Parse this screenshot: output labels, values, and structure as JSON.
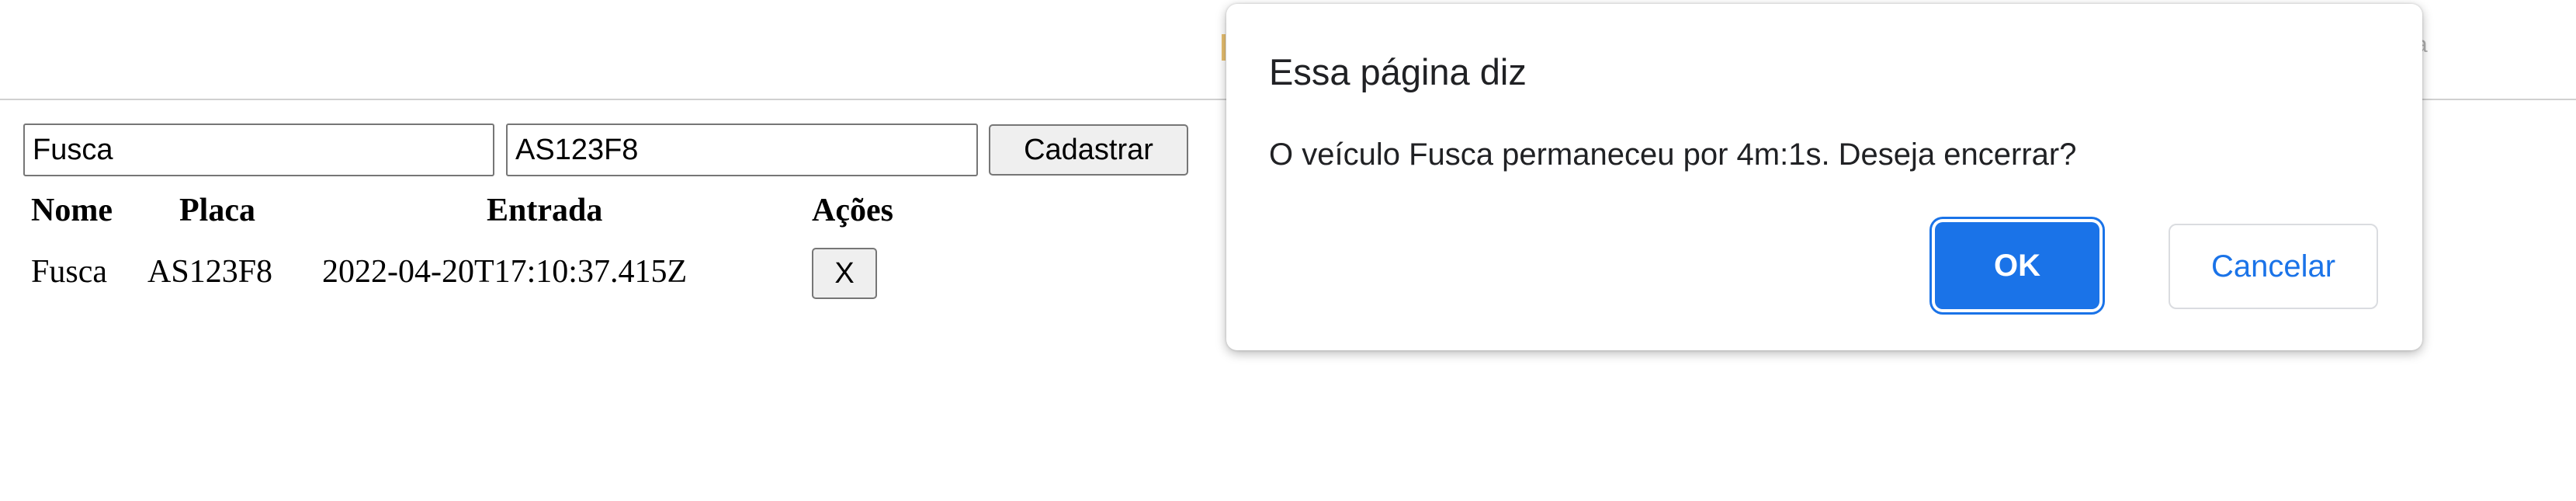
{
  "form": {
    "nome_value": "Fusca",
    "placa_value": "AS123F8",
    "submit_label": "Cadastrar"
  },
  "table": {
    "headers": [
      "Nome",
      "Placa",
      "Entrada",
      "Ações"
    ],
    "rows": [
      {
        "nome": "Fusca",
        "placa": "AS123F8",
        "entrada": "2022-04-20T17:10:37.415Z",
        "action_label": "X"
      }
    ]
  },
  "dialog": {
    "title": "Essa página diz",
    "message": "O veículo Fusca permaneceu por 4m:1s. Deseja encerrar?",
    "ok_label": "OK",
    "cancel_label": "Cancelar"
  },
  "colors": {
    "accent": "#1a73e8",
    "button_bg": "#efefef",
    "input_border": "#767676"
  }
}
